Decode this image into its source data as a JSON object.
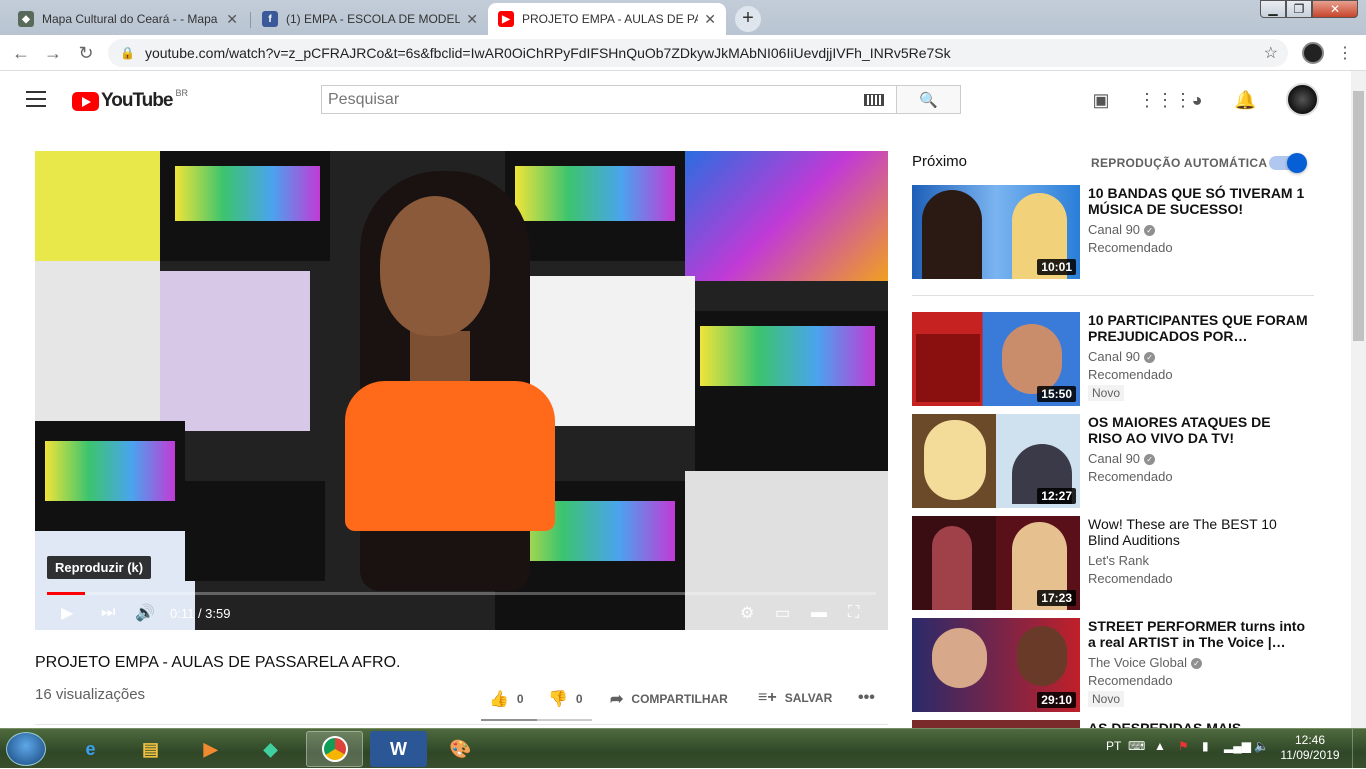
{
  "browser": {
    "tabs": [
      {
        "label": "Mapa Cultural do Ceará - - Mapa",
        "favicon_color": "#5a6a5a"
      },
      {
        "label": "(1) EMPA - ESCOLA DE MODELOS",
        "favicon_color": "#3b5998"
      },
      {
        "label": "PROJETO EMPA - AULAS DE PAS",
        "favicon_color": "#ff0000"
      }
    ],
    "url": "youtube.com/watch?v=z_pCFRAJRCo&t=6s&fbclid=IwAR0OiChRPyFdIFSHnQuOb7ZDkywJkMAbNI06IiUevdjjIVFh_INRv5Re7Sk"
  },
  "youtube": {
    "logo_text": "YouTube",
    "region": "BR",
    "search_placeholder": "Pesquisar"
  },
  "player": {
    "tooltip": "Reproduzir (k)",
    "time": "0:11 / 3:59",
    "progress_fraction": 0.046
  },
  "video": {
    "title": "PROJETO EMPA - AULAS DE PASSARELA AFRO.",
    "views": "16 visualizações",
    "likes": "0",
    "dislikes": "0",
    "share_label": "COMPARTILHAR",
    "save_label": "SALVAR"
  },
  "sidebar": {
    "next_label": "Próximo",
    "autoplay_label": "REPRODUÇÃO AUTOMÁTICA",
    "autoplay_on": true,
    "items": [
      {
        "title": "10 BANDAS QUE SÓ TIVERAM 1 MÚSICA DE SUCESSO!",
        "channel": "Canal 90",
        "meta": "Recomendado",
        "duration": "10:01",
        "badge": ""
      },
      {
        "title": "10 PARTICIPANTES QUE FORAM PREJUDICADOS POR…",
        "channel": "Canal 90",
        "meta": "Recomendado",
        "duration": "15:50",
        "badge": "Novo"
      },
      {
        "title": "OS MAIORES ATAQUES DE RISO AO VIVO DA TV!",
        "channel": "Canal 90",
        "meta": "Recomendado",
        "duration": "12:27",
        "badge": ""
      },
      {
        "title": "Wow! These are The BEST 10 Blind Auditions",
        "channel": "Let's Rank",
        "meta": "Recomendado",
        "duration": "17:23",
        "badge": ""
      },
      {
        "title": "STREET PERFORMER turns into a real ARTIST in The Voice |…",
        "channel": "The Voice Global",
        "meta": "Recomendado",
        "duration": "29:10",
        "badge": "Novo"
      },
      {
        "title": "AS DESPEDIDAS MAIS…",
        "channel": "",
        "meta": "",
        "duration": "",
        "badge": ""
      }
    ]
  },
  "taskbar": {
    "lang": "PT",
    "time": "12:46",
    "date": "11/09/2019"
  }
}
